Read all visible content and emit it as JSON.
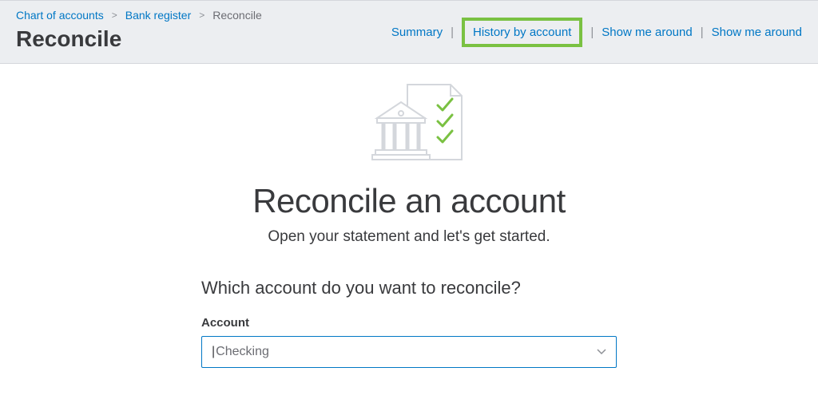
{
  "breadcrumb": {
    "chart": "Chart of accounts",
    "register": "Bank register",
    "current": "Reconcile"
  },
  "page_title": "Reconcile",
  "header_links": {
    "summary": "Summary",
    "history": "History by account",
    "show1": "Show me around",
    "show2": "Show me around"
  },
  "main": {
    "heading": "Reconcile an account",
    "subheading": "Open your statement and let's get started.",
    "question": "Which account do you want to reconcile?",
    "field_label": "Account",
    "account_value": "Checking"
  },
  "colors": {
    "link": "#0077c5",
    "highlight": "#7ac142"
  }
}
